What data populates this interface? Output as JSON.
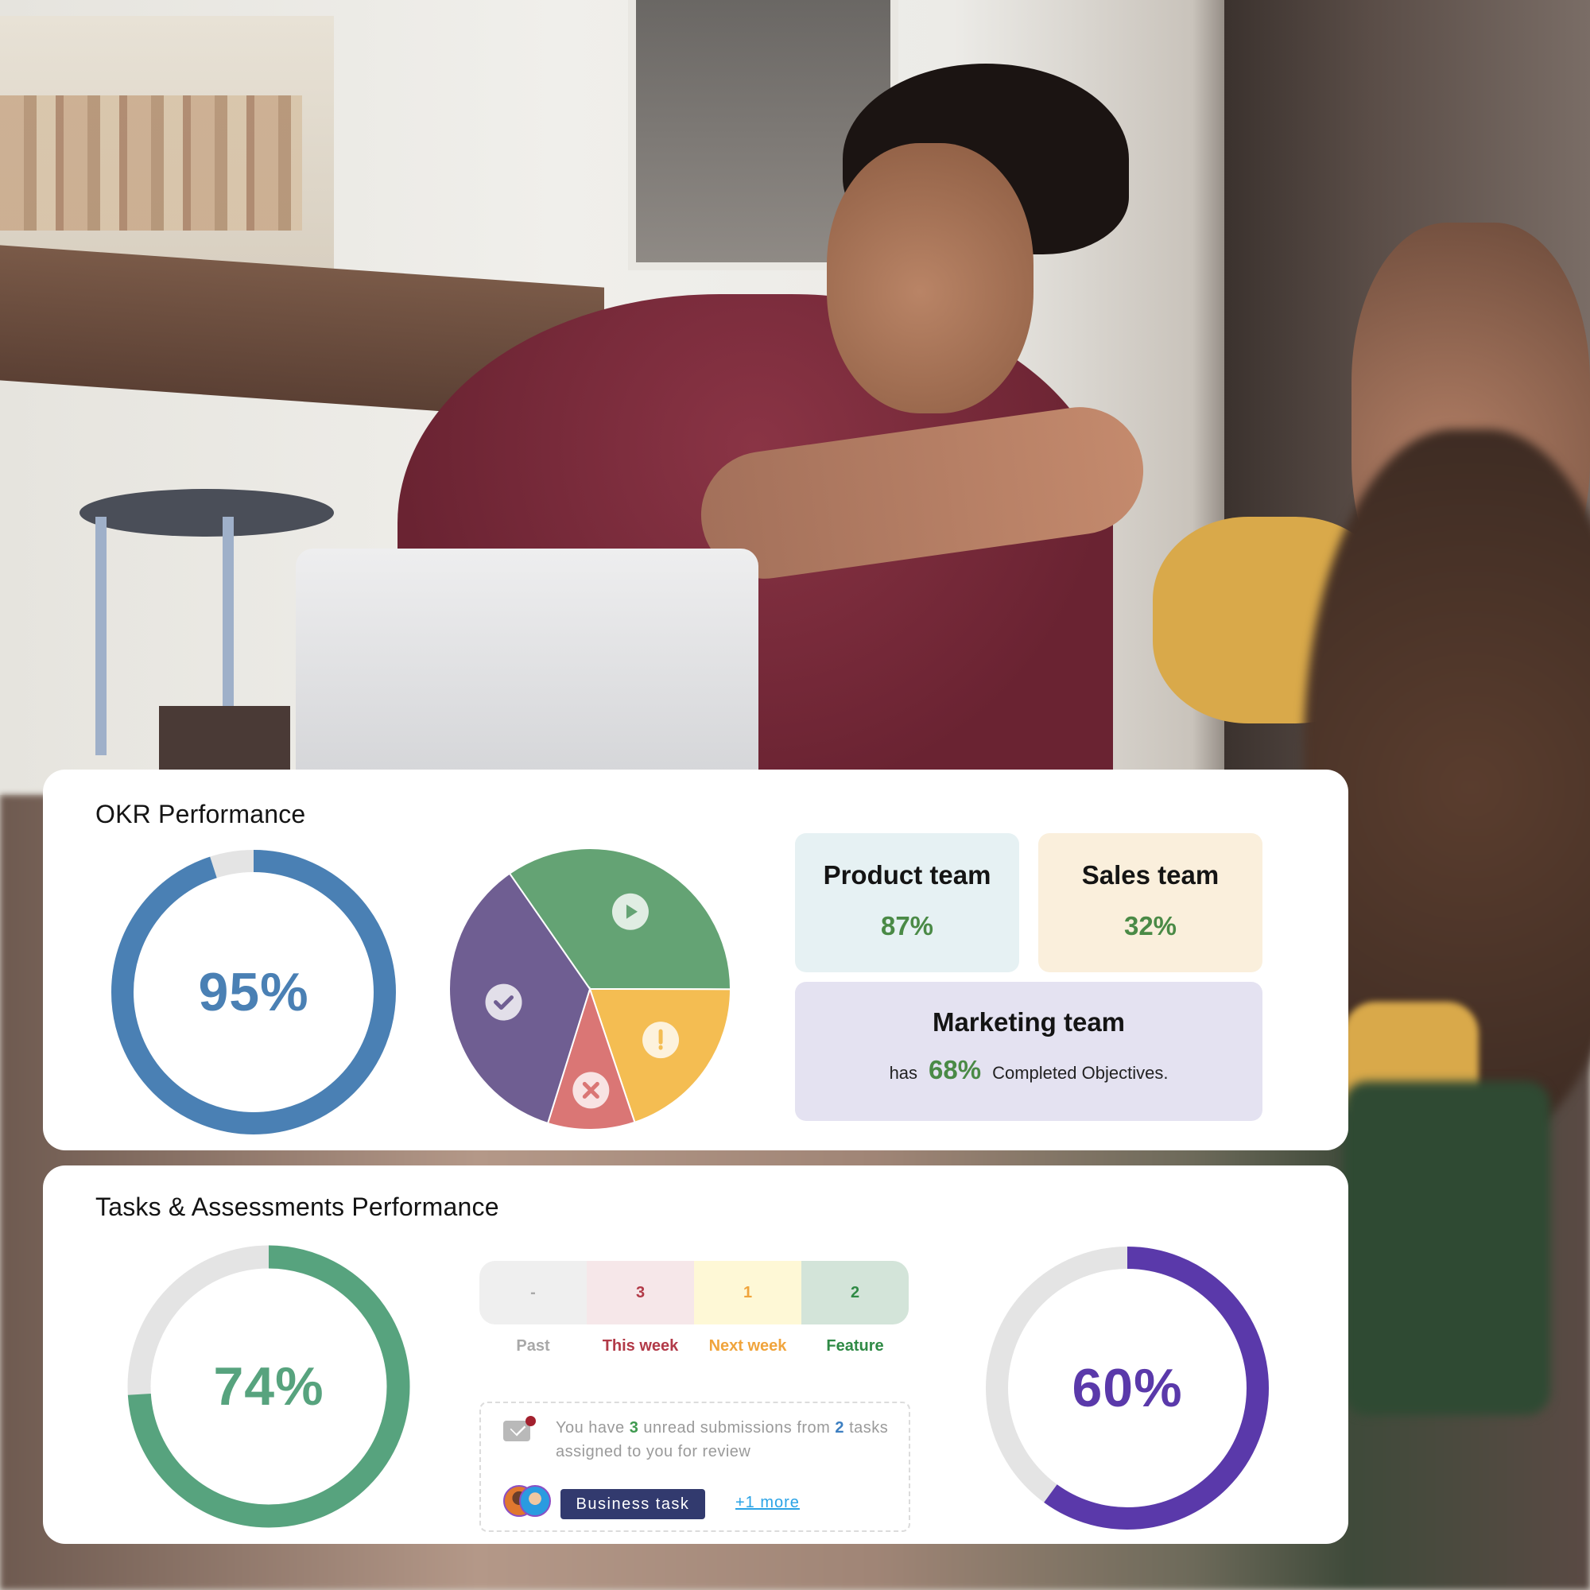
{
  "okr": {
    "title": "OKR Performance",
    "overall": {
      "value": 95,
      "label": "95%",
      "color": "#4a80b4",
      "track": "#e4e4e4"
    },
    "status_pie": {
      "segments": [
        {
          "name": "in-progress",
          "icon": "play-icon",
          "share": 34.7,
          "color": "#64a374"
        },
        {
          "name": "at-risk",
          "icon": "exclamation-icon",
          "share": 19.8,
          "color": "#f4bd52"
        },
        {
          "name": "failed",
          "icon": "x-icon",
          "share": 10.0,
          "color": "#da7675"
        },
        {
          "name": "completed",
          "icon": "check-icon",
          "share": 35.5,
          "color": "#6f5e92"
        }
      ]
    },
    "teams": {
      "product": {
        "name": "Product team",
        "value": "87%",
        "bg": "#e6f1f3"
      },
      "sales": {
        "name": "Sales team",
        "value": "32%",
        "bg": "#faefdc"
      },
      "marketing": {
        "name": "Marketing team",
        "prefix": "has",
        "value": "68%",
        "suffix": "Completed Objectives.",
        "bg": "#e4e2f1"
      }
    }
  },
  "tasks": {
    "title": "Tasks & Assessments Performance",
    "left_donut": {
      "value": 74,
      "label": "74%",
      "color": "#57a37e",
      "track": "#e4e4e4"
    },
    "right_donut": {
      "value": 60,
      "label": "60%",
      "color": "#5a39aa",
      "track": "#e4e4e4"
    },
    "schedule": [
      {
        "label": "Past",
        "count": "-",
        "bg": "#efefef",
        "color": "#a8a8a8"
      },
      {
        "label": "This week",
        "count": "3",
        "bg": "#f6e7e9",
        "color": "#b23a48"
      },
      {
        "label": "Next week",
        "count": "1",
        "bg": "#fef8d6",
        "color": "#f0a43c"
      },
      {
        "label": "Feature",
        "count": "2",
        "bg": "#d3e4d9",
        "color": "#2f8a45"
      }
    ],
    "message": {
      "part1": "You have ",
      "unread": "3",
      "part2": " unread submissions from ",
      "tasks_count": "2",
      "part3": " tasks assigned to you for review",
      "tag": "Business task",
      "more": "+1 more"
    }
  }
}
